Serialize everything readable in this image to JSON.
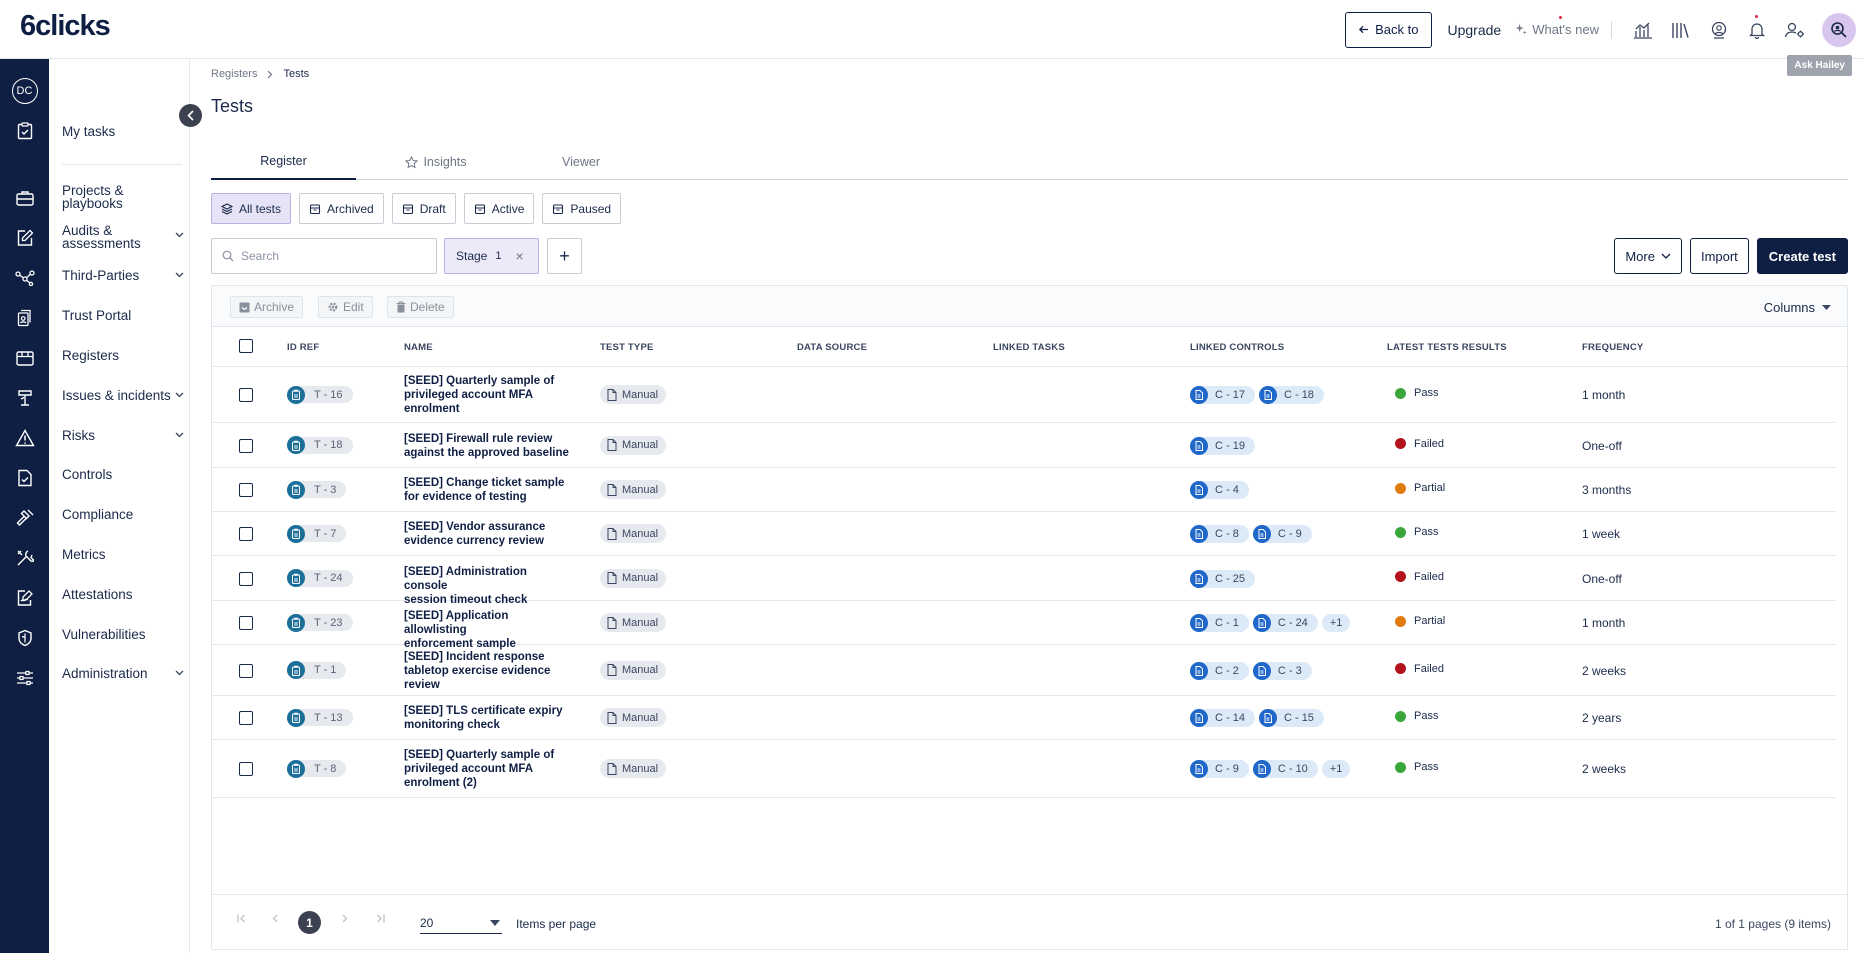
{
  "app": {
    "logo": "6clicks"
  },
  "topbar": {
    "back_label": "Back to",
    "upgrade_label": "Upgrade",
    "whats_new_label": "What's new",
    "tooltip": "Ask Hailey"
  },
  "rail": {
    "user_initials": "DC"
  },
  "sidebar": {
    "items": [
      {
        "label": "My tasks"
      },
      {
        "label": "Projects & playbooks"
      },
      {
        "label": "Audits & assessments"
      },
      {
        "label": "Third-Parties"
      },
      {
        "label": "Trust Portal"
      },
      {
        "label": "Registers"
      },
      {
        "label": "Issues & incidents"
      },
      {
        "label": "Risks"
      },
      {
        "label": "Controls"
      },
      {
        "label": "Compliance"
      },
      {
        "label": "Metrics"
      },
      {
        "label": "Attestations"
      },
      {
        "label": "Vulnerabilities"
      },
      {
        "label": "Administration"
      }
    ]
  },
  "breadcrumb": {
    "parent": "Registers",
    "current": "Tests"
  },
  "page": {
    "title": "Tests"
  },
  "tabs": [
    {
      "label": "Register"
    },
    {
      "label": "Insights"
    },
    {
      "label": "Viewer"
    }
  ],
  "filters": [
    {
      "label": "All tests"
    },
    {
      "label": "Archived"
    },
    {
      "label": "Draft"
    },
    {
      "label": "Active"
    },
    {
      "label": "Paused"
    }
  ],
  "search": {
    "placeholder": "Search",
    "value": ""
  },
  "stage_filter": {
    "label": "Stage",
    "count": "1",
    "remove": "×"
  },
  "add_filter": "+",
  "actions": {
    "more": "More",
    "import": "Import",
    "create": "Create test"
  },
  "toolbar": {
    "archive": "Archive",
    "edit": "Edit",
    "delete": "Delete",
    "columns": "Columns"
  },
  "table": {
    "headers": {
      "id_ref": "ID REF",
      "name": "NAME",
      "test_type": "TEST TYPE",
      "data_source": "DATA SOURCE",
      "linked_tasks": "LINKED TASKS",
      "linked_controls": "LINKED CONTROLS",
      "latest_results": "LATEST TESTS RESULTS",
      "frequency": "FREQUENCY"
    },
    "rows": [
      {
        "id": "T - 16",
        "name_lines": [
          "[SEED] Quarterly sample of",
          "privileged account MFA",
          "enrolment"
        ],
        "type": "Manual",
        "controls": [
          "C - 17",
          "C - 18"
        ],
        "more": "",
        "result": "Pass",
        "frequency": "1 month"
      },
      {
        "id": "T - 18",
        "name_lines": [
          "[SEED] Firewall rule review",
          "against the approved baseline"
        ],
        "type": "Manual",
        "controls": [
          "C - 19"
        ],
        "more": "",
        "result": "Failed",
        "frequency": "One-off"
      },
      {
        "id": "T - 3",
        "name_lines": [
          "[SEED] Change ticket sample",
          "for evidence of testing"
        ],
        "type": "Manual",
        "controls": [
          "C - 4"
        ],
        "more": "",
        "result": "Partial",
        "frequency": "3 months"
      },
      {
        "id": "T - 7",
        "name_lines": [
          "[SEED] Vendor assurance",
          "evidence currency review"
        ],
        "type": "Manual",
        "controls": [
          "C - 8",
          "C - 9"
        ],
        "more": "",
        "result": "Pass",
        "frequency": "1 week"
      },
      {
        "id": "T - 24",
        "name_lines": [
          "[SEED] Administration console",
          "session timeout check"
        ],
        "type": "Manual",
        "controls": [
          "C - 25"
        ],
        "more": "",
        "result": "Failed",
        "frequency": "One-off"
      },
      {
        "id": "T - 23",
        "name_lines": [
          "[SEED] Application allowlisting",
          "enforcement sample"
        ],
        "type": "Manual",
        "controls": [
          "C - 1",
          "C - 24"
        ],
        "more": "+1",
        "result": "Partial",
        "frequency": "1 month"
      },
      {
        "id": "T - 1",
        "name_lines": [
          "[SEED] Incident response",
          "tabletop exercise evidence",
          "review"
        ],
        "type": "Manual",
        "controls": [
          "C - 2",
          "C - 3"
        ],
        "more": "",
        "result": "Failed",
        "frequency": "2 weeks"
      },
      {
        "id": "T - 13",
        "name_lines": [
          "[SEED] TLS certificate expiry",
          "monitoring check"
        ],
        "type": "Manual",
        "controls": [
          "C - 14",
          "C - 15"
        ],
        "more": "",
        "result": "Pass",
        "frequency": "2 years"
      },
      {
        "id": "T - 8",
        "name_lines": [
          "[SEED] Quarterly sample of",
          "privileged account MFA",
          "enrolment (2)"
        ],
        "type": "Manual",
        "controls": [
          "C - 9",
          "C - 10"
        ],
        "more": "+1",
        "result": "Pass",
        "frequency": "2 weeks"
      }
    ]
  },
  "status_colors": {
    "Pass": "#3aa63a",
    "Failed": "#b3121d",
    "Partial": "#e07b10"
  },
  "pagination": {
    "current_page": "1",
    "per_page": "20",
    "per_page_label": "Items per page",
    "info": "1 of 1 pages (9 items)"
  }
}
